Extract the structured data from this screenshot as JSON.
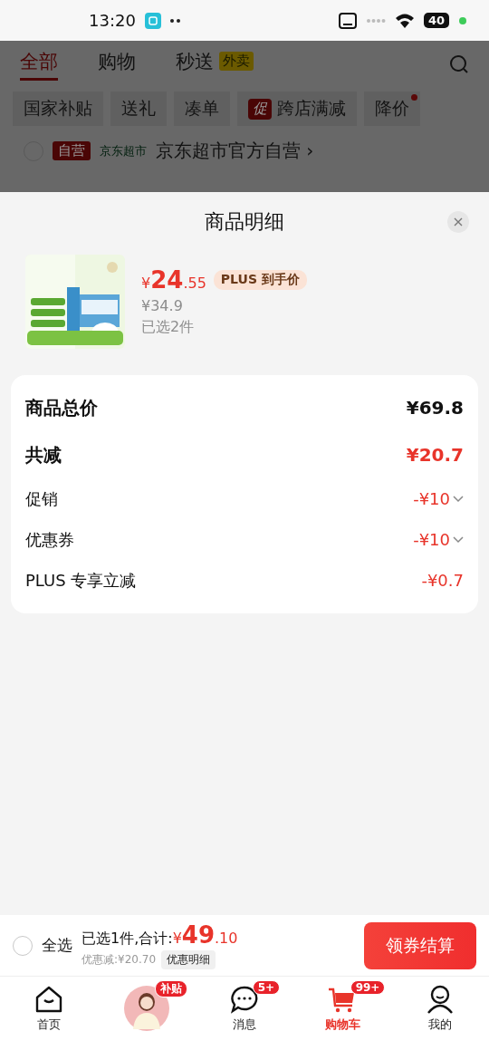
{
  "status_bar": {
    "time": "13:20",
    "battery": "40"
  },
  "top_tabs": [
    {
      "label": "全部",
      "selected": true
    },
    {
      "label": "购物",
      "selected": false
    },
    {
      "label": "秒送",
      "badge": "外卖",
      "selected": false
    }
  ],
  "filter_chips": [
    {
      "label": "国家补贴"
    },
    {
      "label": "送礼"
    },
    {
      "label": "凑单"
    },
    {
      "label": "跨店满减",
      "tag": "促"
    },
    {
      "label": "降价",
      "dot": true
    }
  ],
  "store": {
    "checked": false,
    "tag": "自营",
    "brand": "京东超市",
    "name": "京东超市官方自营",
    "arrow": "›"
  },
  "sheet": {
    "title": "商品明细",
    "product": {
      "currency": "¥",
      "price_int": "24",
      "price_dec": ".55",
      "plus_label": "PLUS 到手价",
      "original_price": "¥34.9",
      "selected_count": "已选2件"
    },
    "summary": [
      {
        "kind": "major",
        "label": "商品总价",
        "value": "¥69.8",
        "highlight": false,
        "expandable": false
      },
      {
        "kind": "major",
        "label": "共减",
        "value": "¥20.7",
        "highlight": true,
        "expandable": false
      },
      {
        "kind": "minor",
        "label": "促销",
        "value": "-¥10",
        "highlight": true,
        "expandable": true
      },
      {
        "kind": "minor",
        "label": "优惠券",
        "value": "-¥10",
        "highlight": true,
        "expandable": true
      },
      {
        "kind": "minor",
        "label": "PLUS 专享立减",
        "value": "-¥0.7",
        "highlight": true,
        "expandable": false
      }
    ]
  },
  "checkout_bar": {
    "select_all": {
      "checked": false,
      "label": "全选"
    },
    "summary": "已选1件,合计:",
    "currency": "¥",
    "total_int": "49",
    "total_dec": ".10",
    "discount": "优惠减:¥20.70",
    "detail_button": "优惠明细",
    "checkout_button": "领券结算"
  },
  "bottom_nav": [
    {
      "kind": "home",
      "label": "首页",
      "selected": false
    },
    {
      "kind": "promo",
      "badge": "补贴",
      "selected": false
    },
    {
      "kind": "message",
      "label": "消息",
      "badge": "5+",
      "selected": false
    },
    {
      "kind": "cart",
      "label": "购物车",
      "badge": "99+",
      "selected": true
    },
    {
      "kind": "profile",
      "label": "我的",
      "selected": false
    }
  ]
}
